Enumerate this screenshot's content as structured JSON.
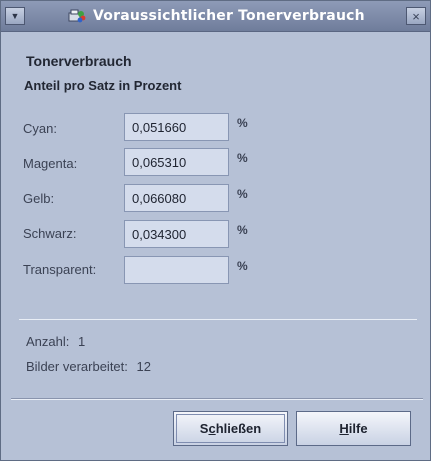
{
  "window": {
    "title": "Voraussichtlicher Tonerverbrauch"
  },
  "headings": {
    "title": "Tonerverbrauch",
    "subtitle": "Anteil pro Satz in Prozent"
  },
  "rows": [
    {
      "label": "Cyan:",
      "value": "0,051660",
      "unit": "%"
    },
    {
      "label": "Magenta:",
      "value": "0,065310",
      "unit": "%"
    },
    {
      "label": "Gelb:",
      "value": "0,066080",
      "unit": "%"
    },
    {
      "label": "Schwarz:",
      "value": "0,034300",
      "unit": "%"
    },
    {
      "label": "Transparent:",
      "value": "",
      "unit": "%"
    }
  ],
  "stats": {
    "count_label": "Anzahl:",
    "count_value": "1",
    "processed_label": "Bilder verarbeitet:",
    "processed_value": "12"
  },
  "buttons": {
    "close": {
      "pre": "S",
      "mnemonic": "c",
      "post": "hließen"
    },
    "help": {
      "pre": "",
      "mnemonic": "H",
      "post": "ilfe"
    }
  },
  "colors": {
    "window_bg": "#b6c1d6",
    "titlebar": "#7f8cab",
    "field_bg": "#d4dcec"
  },
  "icons": [
    "system-menu-icon",
    "app-icon",
    "close-icon"
  ]
}
